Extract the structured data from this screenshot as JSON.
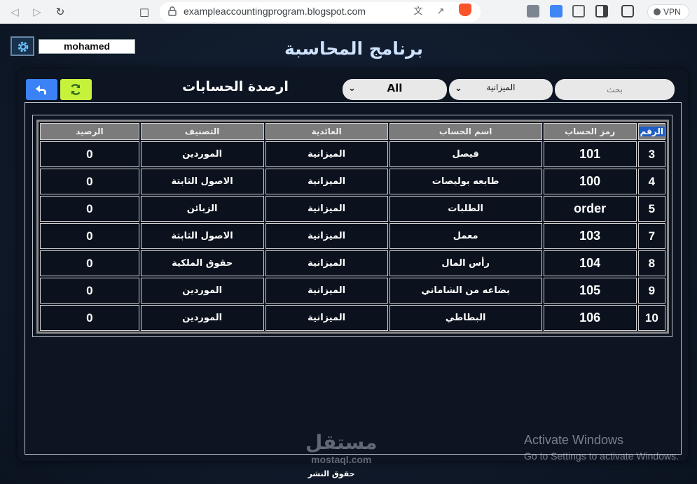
{
  "browser": {
    "url": "exampleaccountingprogram.blogspot.com",
    "vpn_label": "VPN"
  },
  "header": {
    "username": "mohamed",
    "app_title": "برنامج المحاسبة"
  },
  "panel": {
    "title": "ارصدة الحسابات",
    "filter_all": "All",
    "filter_type": "الميزانية",
    "search_placeholder": "بحث"
  },
  "table": {
    "columns": [
      "الرقم",
      "رمز الحساب",
      "اسم الحساب",
      "العائدية",
      "التصنيف",
      "الرصيد"
    ],
    "rows": [
      [
        "3",
        "101",
        "فيصل",
        "الميزانية",
        "الموردين",
        "0"
      ],
      [
        "4",
        "100",
        "طابعه بوليصات",
        "الميزانية",
        "الاصول الثابتة",
        "0"
      ],
      [
        "5",
        "order",
        "الطلبات",
        "الميزانية",
        "الزبائن",
        "0"
      ],
      [
        "7",
        "103",
        "معمل",
        "الميزانية",
        "الاصول الثابتة",
        "0"
      ],
      [
        "8",
        "104",
        "رأس المال",
        "الميزانية",
        "حقوق الملكية",
        "0"
      ],
      [
        "9",
        "105",
        "بضاعه من الشاماني",
        "الميزانية",
        "الموردين",
        "0"
      ],
      [
        "10",
        "106",
        "البطاطي",
        "الميزانية",
        "الموردين",
        "0"
      ]
    ]
  },
  "watermark": {
    "activate_title": "Activate Windows",
    "activate_sub": "Go to Settings to activate Windows.",
    "site_ar": "مستقل",
    "site_en": "mostaql.com"
  },
  "footer": {
    "copyright": "حقوق النشر"
  },
  "colors": {
    "accent_blue": "#3b82f6",
    "accent_lime": "#c6f23c",
    "panel_bg": "#0d1523"
  }
}
